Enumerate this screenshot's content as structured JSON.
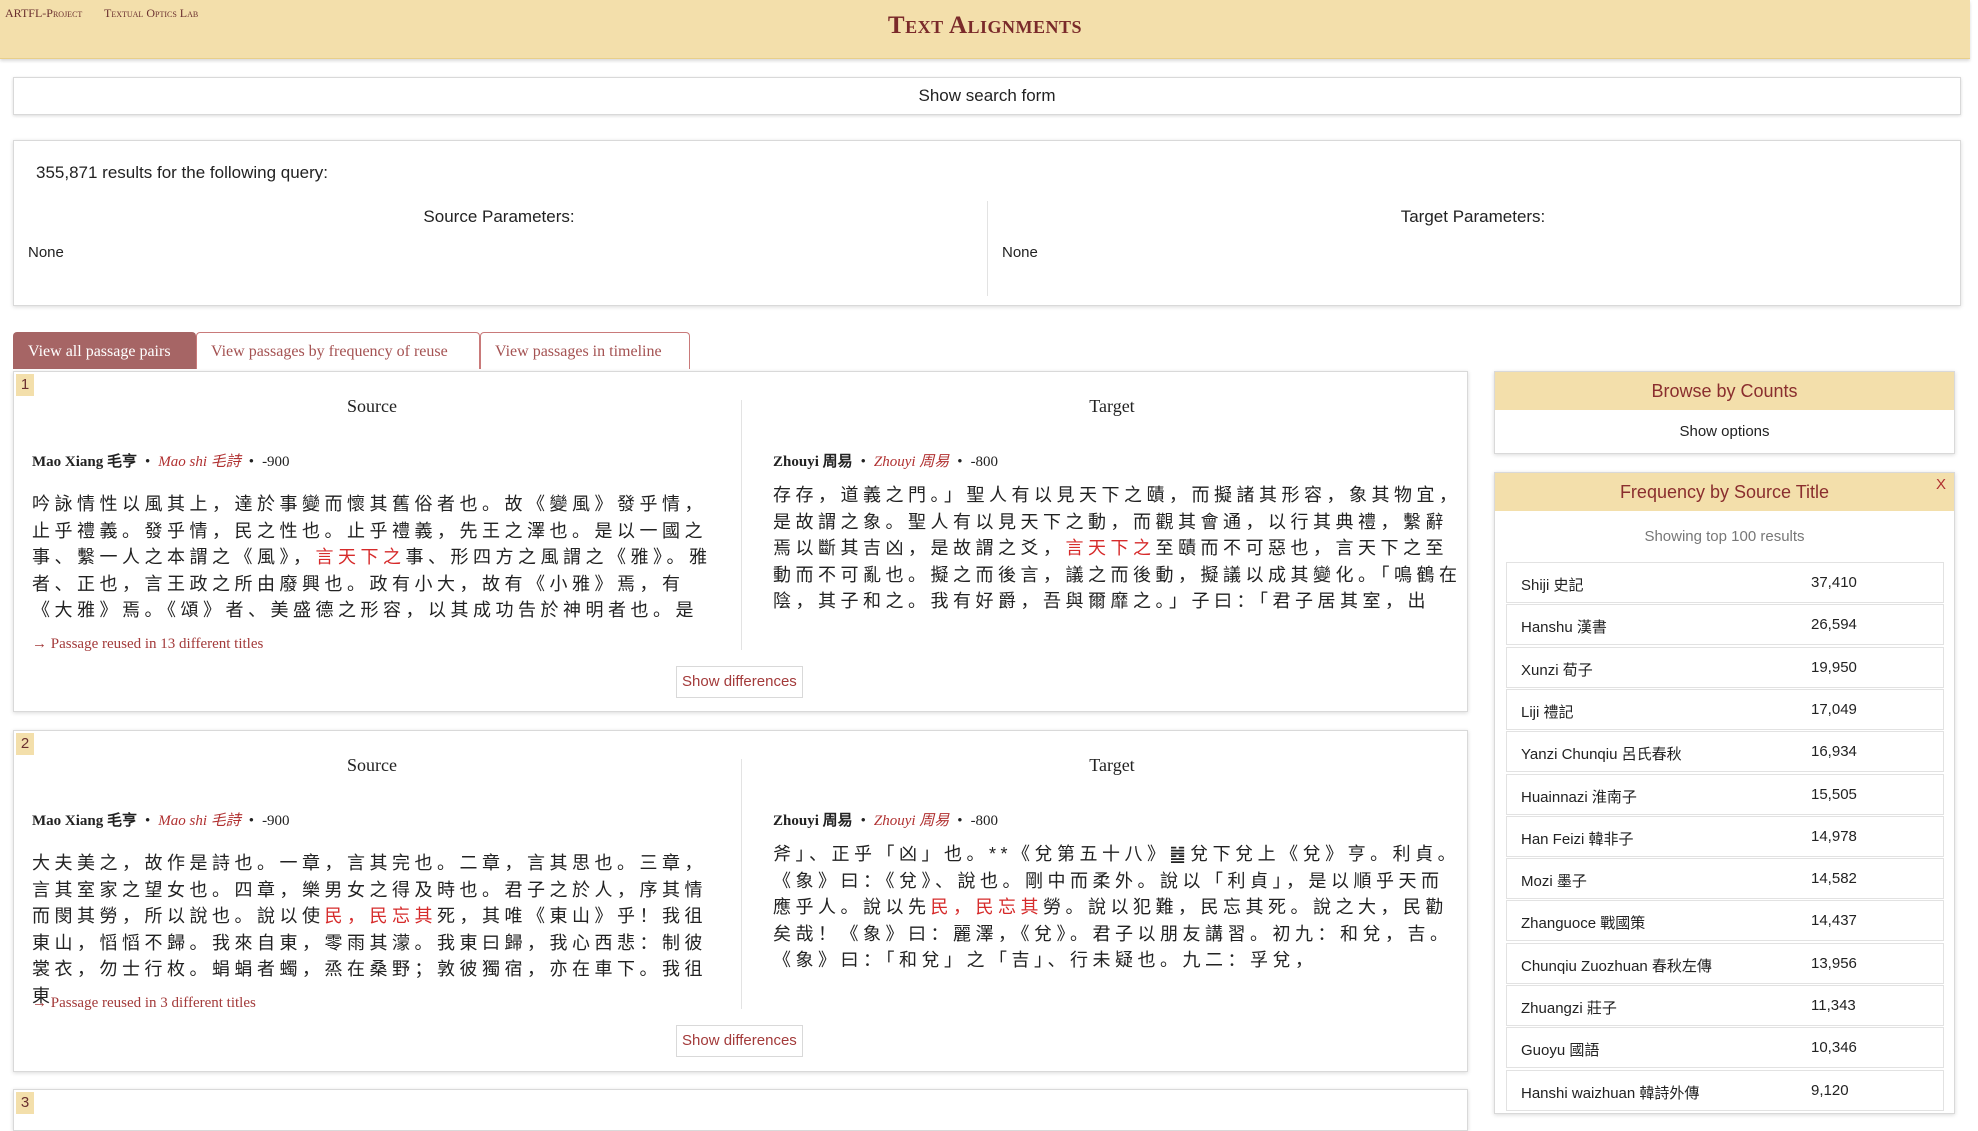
{
  "header": {
    "link1": "ARTFL-Project",
    "link2": "Textual Optics Lab",
    "title": "Text Alignments"
  },
  "search_toggle": "Show search form",
  "query": {
    "results_text": "355,871 results for the following query:",
    "source_heading": "Source Parameters:",
    "source_value": "None",
    "target_heading": "Target Parameters:",
    "target_value": "None"
  },
  "tabs": [
    {
      "label": "View all passage pairs",
      "active": true
    },
    {
      "label": "View passages by frequency of reuse",
      "active": false
    },
    {
      "label": "View passages in timeline",
      "active": false
    }
  ],
  "passages": [
    {
      "number": "1",
      "source_heading": "Source",
      "target_heading": "Target",
      "source": {
        "author": "Mao Xiang 毛亨",
        "title": "Mao shi 毛詩",
        "date": "-900",
        "text_before": "吟詠情性以風其上，達於事變而懷其舊俗者也。故《變風》發乎情，止乎禮義。發乎情，民之性也。止乎禮義，先王之澤也。是以一國之事、繫一人之本謂之《風》，",
        "match": "言天下之",
        "text_after": "事、形四方之風謂之《雅》。雅者、正也，言王政之所由廢興也。政有小大，故有《小雅》焉，有《大雅》焉。《頌》者、美盛德之形容，以其成功告於神明者也。是"
      },
      "target": {
        "author": "Zhouyi 周易",
        "title": "Zhouyi 周易",
        "date": "-800",
        "text_before": "存存，道義之門。」聖人有以見天下之賾，而擬諸其形容，象其物宜，是故謂之象。聖人有以見天下之動，而觀其會通，以行其典禮，繫辭焉以斷其吉凶，是故謂之爻，",
        "match": "言天下之",
        "text_after": "至賾而不可惡也，言天下之至動而不可亂也。擬之而後言，議之而後動，擬議以成其變化。「鳴鶴在陰，其子和之。我有好爵，吾與爾靡之。」子曰：「君子居其室，出"
      },
      "reuse_text": "→ Passage reused in 13 different titles",
      "diff_button": "Show differences"
    },
    {
      "number": "2",
      "source_heading": "Source",
      "target_heading": "Target",
      "source": {
        "author": "Mao Xiang 毛亨",
        "title": "Mao shi 毛詩",
        "date": "-900",
        "text_before": "大夫美之，故作是詩也。一章，言其完也。二章，言其思也。三章，言其室家之望女也。四章，樂男女之得及時也。君子之於人，序其情而閔其勞，所以說也。說以使",
        "match": "民，民忘其",
        "text_after": "死，其唯《東山》乎！我徂東山，慆慆不歸。我來自東，零雨其濛。我東曰歸，我心西悲：制彼裳衣，勿士行枚。蜎蜎者蠋，烝在桑野；敦彼獨宿，亦在車下。我徂東"
      },
      "target": {
        "author": "Zhouyi 周易",
        "title": "Zhouyi 周易",
        "date": "-800",
        "text_before": "斧」、正乎「凶」也。**《兌第五十八》䷹兌下兌上《兌》亨。利貞。《象》曰：《兌》、說也。剛中而柔外。說以「利貞」，是以順乎天而應乎人。說以先",
        "match": "民，民忘其",
        "text_after": "勞。說以犯難，民忘其死。說之大，民勸矣哉！《象》曰：麗澤，《兌》。君子以朋友講習。初九：和兌，吉。《象》曰：「和兌」之「吉」、行未疑也。九二：孚兌，"
      },
      "reuse_text": "→ Passage reused in 3 different titles",
      "diff_button": "Show differences"
    }
  ],
  "passage3_number": "3",
  "browse": {
    "title": "Browse by Counts",
    "options_label": "Show options"
  },
  "frequency": {
    "title": "Frequency by Source  Title",
    "close": "X",
    "subtitle": "Showing top 100 results",
    "rows": [
      {
        "name": "Shiji 史記",
        "count": "37,410"
      },
      {
        "name": "Hanshu 漢書",
        "count": "26,594"
      },
      {
        "name": "Xunzi 荀子",
        "count": "19,950"
      },
      {
        "name": "Liji 禮記",
        "count": "17,049"
      },
      {
        "name": "Yanzi Chunqiu 呂氏春秋",
        "count": "16,934"
      },
      {
        "name": "Huainnazi 淮南子",
        "count": "15,505"
      },
      {
        "name": "Han Feizi 韓非子",
        "count": "14,978"
      },
      {
        "name": "Mozi 墨子",
        "count": "14,582"
      },
      {
        "name": "Zhanguoce 戰國策",
        "count": "14,437"
      },
      {
        "name": "Chunqiu Zuozhuan 春秋左傳",
        "count": "13,956"
      },
      {
        "name": "Zhuangzi 莊子",
        "count": "11,343"
      },
      {
        "name": "Guoyu 國語",
        "count": "10,346"
      },
      {
        "name": "Hanshi waizhuan 韓詩外傳",
        "count": "9,120"
      }
    ]
  },
  "colors": {
    "header_bg": "#f3dfab",
    "accent": "#a66565",
    "highlight": "#d62b2b",
    "title_red": "#7a2a2a"
  }
}
